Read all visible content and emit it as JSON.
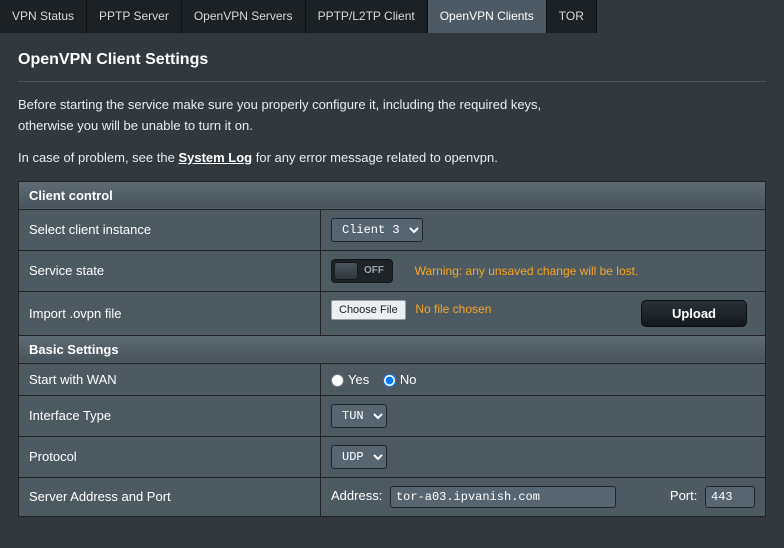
{
  "tabs": {
    "items": [
      {
        "label": "VPN Status"
      },
      {
        "label": "PPTP Server"
      },
      {
        "label": "OpenVPN Servers"
      },
      {
        "label": "PPTP/L2TP Client"
      },
      {
        "label": "OpenVPN Clients"
      },
      {
        "label": "TOR"
      }
    ],
    "active_index": 4
  },
  "page": {
    "title": "OpenVPN Client Settings",
    "intro_line1": "Before starting the service make sure you properly configure it, including the required keys,",
    "intro_line2": "otherwise you will be unable to turn it on.",
    "intro2_pre": "In case of problem, see the ",
    "intro2_link": "System Log",
    "intro2_post": " for any error message related to openvpn."
  },
  "sections": {
    "client_control": "Client control",
    "basic_settings": "Basic Settings"
  },
  "rows": {
    "select_client": {
      "label": "Select client instance",
      "value": "Client 3"
    },
    "service_state": {
      "label": "Service state",
      "state": "OFF",
      "warning": "Warning: any unsaved change will be lost."
    },
    "import": {
      "label": "Import .ovpn file",
      "choose_btn": "Choose File",
      "status": "No file chosen",
      "upload_btn": "Upload"
    },
    "start_wan": {
      "label": "Start with WAN",
      "yes": "Yes",
      "no": "No",
      "value": "No"
    },
    "interface_type": {
      "label": "Interface Type",
      "value": "TUN"
    },
    "protocol": {
      "label": "Protocol",
      "value": "UDP"
    },
    "server": {
      "label": "Server Address and Port",
      "address_label": "Address:",
      "address_value": "tor-a03.ipvanish.com",
      "port_label": "Port:",
      "port_value": "443"
    }
  }
}
